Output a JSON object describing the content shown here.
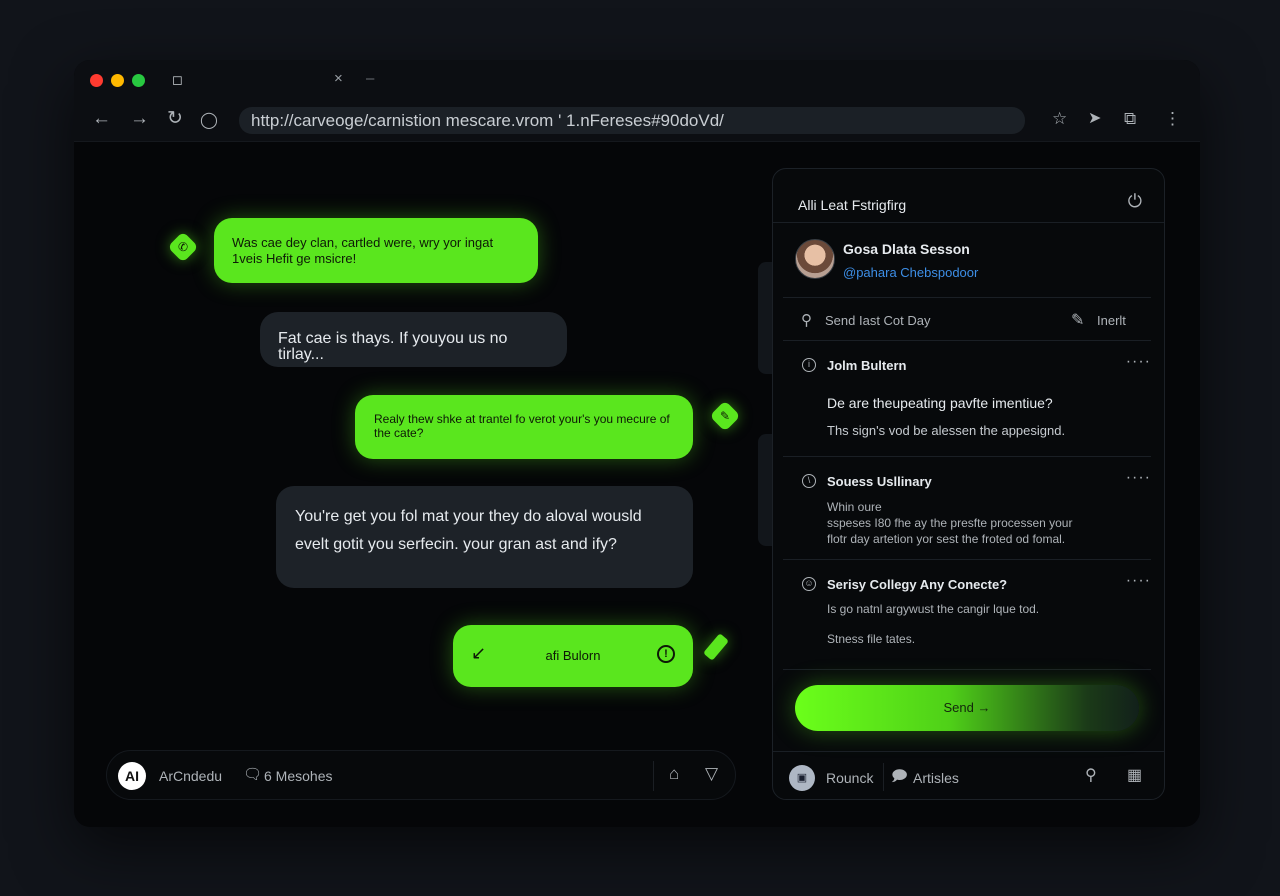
{
  "browser": {
    "tab_icon": "◻",
    "tab_close": "×",
    "url": "http://carveoge/carnistion mescare.vrom ' 1.nFereses#90doVd/"
  },
  "chat": {
    "messages": [
      {
        "type": "outgoing",
        "text": "Was cae dey clan, cartled were, wry yor ingat 1veis Hefit ge msicre!"
      },
      {
        "type": "incoming",
        "text": "Fat cae is thays. If youyou us no tirlay..."
      },
      {
        "type": "outgoing",
        "text": "Realy thew shke at trantel fo verot your's you mecure of the cate?"
      },
      {
        "type": "incoming",
        "text": "You're get you fol mat your they do aloval wousld evelt gotit you serfecin. your gran ast and ify?"
      }
    ],
    "action_bubble": {
      "label": "afi Bulorn"
    },
    "bottombar": {
      "avatar": "AI",
      "name": "ArCndedu",
      "count": "6 Mesohes"
    }
  },
  "panel": {
    "title": "Alli Leat Fstrigfirg",
    "user": {
      "name": "Gosa Dlata Sesson",
      "handle": "@pahara Chebspodoor"
    },
    "search": {
      "placeholder": "Send Iast Cot Day",
      "insert_label": "Inerlt"
    },
    "sections": [
      {
        "title": "Jolm Bultern",
        "icon": "i",
        "lines": [
          "De are theupeating pavfte imentiue?",
          "Ths sign's vod be alessen the appesignd."
        ]
      },
      {
        "title": "Souess Usllinary",
        "icon": "\\",
        "lines": [
          "Whin oure",
          "sspeses I80 fhe ay the presfte processen your",
          "flotr day artetion yor sest the froted od fomal."
        ]
      },
      {
        "title": "Serisy Collegy Any Conecte?",
        "icon": "☺",
        "lines": [
          "Is go natnl argywust the cangir lque tod.",
          "Stness file tates."
        ]
      }
    ],
    "send_label": "Send →",
    "footer": {
      "avatar": "▣",
      "name": "Rounck",
      "articles": "Artisles"
    }
  },
  "colors": {
    "accent": "#5ae61e",
    "link": "#3d8ee6",
    "background": "#050608"
  }
}
